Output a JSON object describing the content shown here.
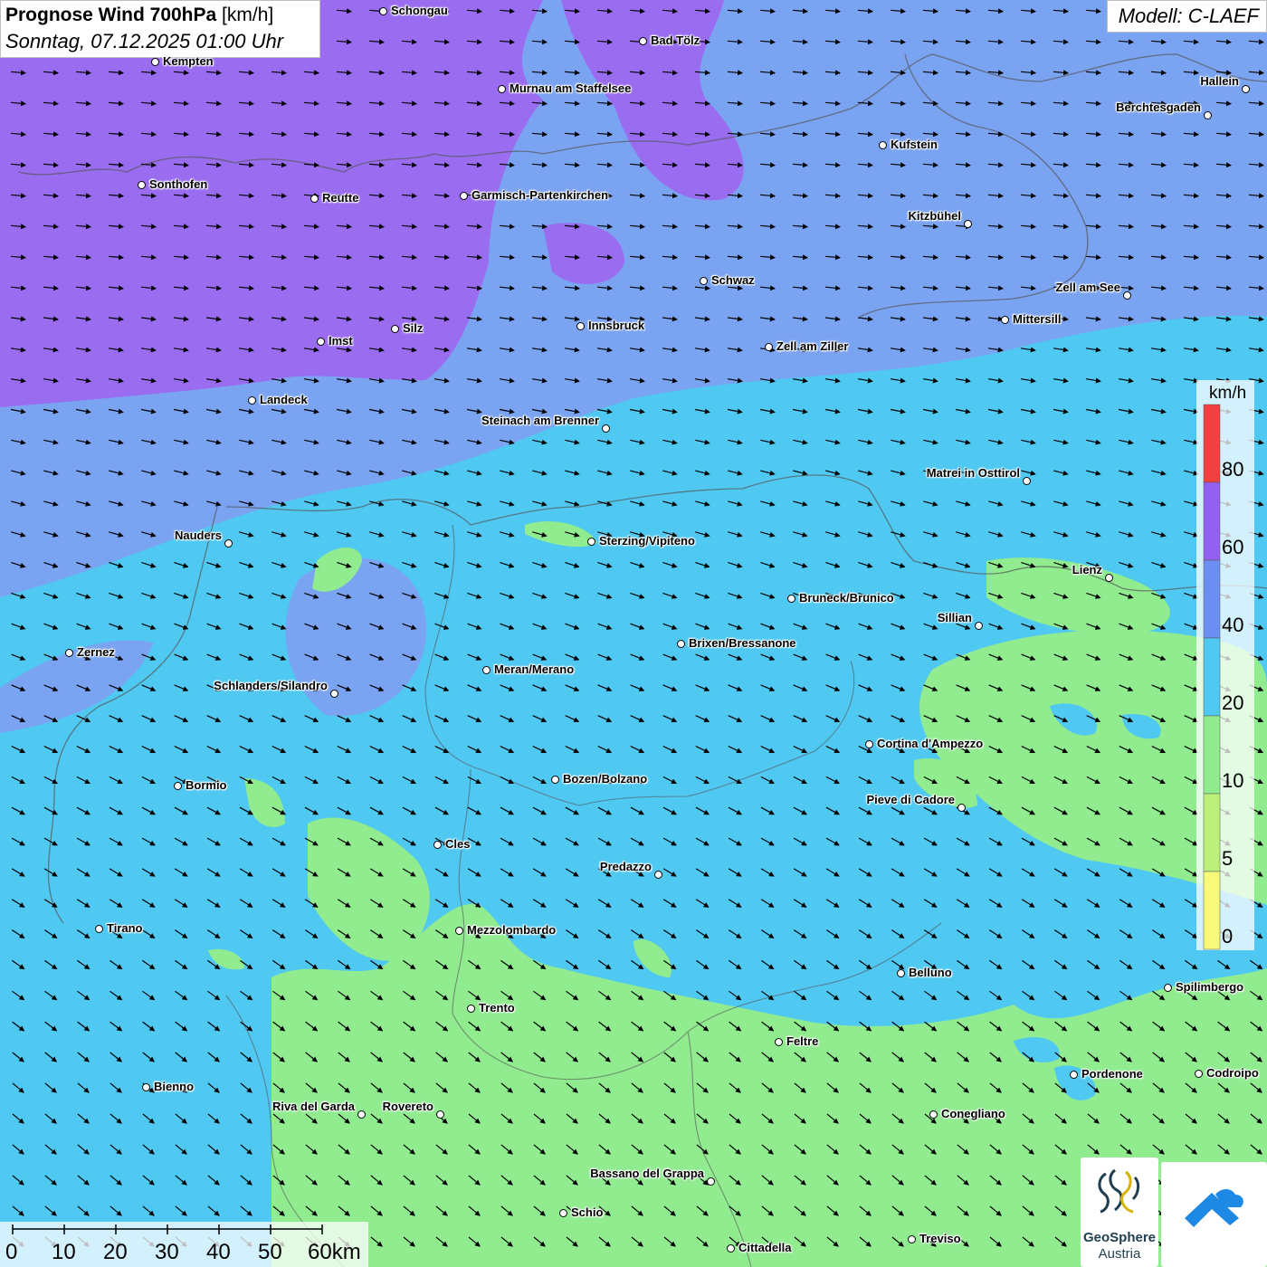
{
  "header": {
    "title_bold": "Prognose Wind 700hPa",
    "title_unit": "[km/h]",
    "subtitle": "Sonntag, 07.12.2025 01:00 Uhr",
    "model": "Modell: C-LAEF"
  },
  "colors": {
    "class_0_5": "#f6f97a",
    "class_5_10": "#bdf07a",
    "class_10_20": "#90ec8f",
    "class_20_40": "#4fc8f2",
    "class_40_60": "#6b8ef0",
    "class_60_80": "#9460f0",
    "class_80_plus": "#f04040",
    "arrows": "#000000",
    "borders": "#555555"
  },
  "legend": {
    "unit": "km/h",
    "labels": [
      "80",
      "60",
      "40",
      "20",
      "10",
      "5",
      "0"
    ]
  },
  "wind": {
    "north_direction": "west-northwest (arrows pointing east)",
    "south_direction": "northwest (arrows pointing southeast)"
  },
  "cities": [
    {
      "name": "Schongau"
    },
    {
      "name": "Bad Tölz"
    },
    {
      "name": "Kempten"
    },
    {
      "name": "Murnau am Staffelsee"
    },
    {
      "name": "Hallein"
    },
    {
      "name": "Berchtesgaden"
    },
    {
      "name": "Kufstein"
    },
    {
      "name": "Sonthofen"
    },
    {
      "name": "Reutte"
    },
    {
      "name": "Garmisch-Partenkirchen"
    },
    {
      "name": "Kitzbühel"
    },
    {
      "name": "Schwaz"
    },
    {
      "name": "Zell am See"
    },
    {
      "name": "Innsbruck"
    },
    {
      "name": "Mittersill"
    },
    {
      "name": "Silz"
    },
    {
      "name": "Imst"
    },
    {
      "name": "Zell am Ziller"
    },
    {
      "name": "Landeck"
    },
    {
      "name": "Steinach am Brenner"
    },
    {
      "name": "Matrei in Osttirol"
    },
    {
      "name": "Nauders"
    },
    {
      "name": "Sterzing/Vipiteno"
    },
    {
      "name": "Lienz"
    },
    {
      "name": "Bruneck/Brunico"
    },
    {
      "name": "Sillian"
    },
    {
      "name": "Brixen/Bressanone"
    },
    {
      "name": "Zernez"
    },
    {
      "name": "Meran/Merano"
    },
    {
      "name": "Schlanders/Silandro"
    },
    {
      "name": "Cortina d'Ampezzo"
    },
    {
      "name": "Bozen/Bolzano"
    },
    {
      "name": "Bormio"
    },
    {
      "name": "Pieve di Cadore"
    },
    {
      "name": "Cles"
    },
    {
      "name": "Predazzo"
    },
    {
      "name": "Tirano"
    },
    {
      "name": "Mezzolombardo"
    },
    {
      "name": "Belluno"
    },
    {
      "name": "Spilimbergo"
    },
    {
      "name": "Trento"
    },
    {
      "name": "Feltre"
    },
    {
      "name": "Pordenone"
    },
    {
      "name": "Codroipo"
    },
    {
      "name": "Bienno"
    },
    {
      "name": "Riva del Garda"
    },
    {
      "name": "Rovereto"
    },
    {
      "name": "Conegliano"
    },
    {
      "name": "Bassano del Grappa"
    },
    {
      "name": "Schio"
    },
    {
      "name": "Treviso"
    },
    {
      "name": "Cittadella"
    }
  ],
  "scale": {
    "labels": [
      "0",
      "10",
      "20",
      "30",
      "40",
      "50",
      "60km"
    ]
  },
  "logos": {
    "geosphere_name": "GeoSphere",
    "geosphere_sub": "Austria"
  }
}
